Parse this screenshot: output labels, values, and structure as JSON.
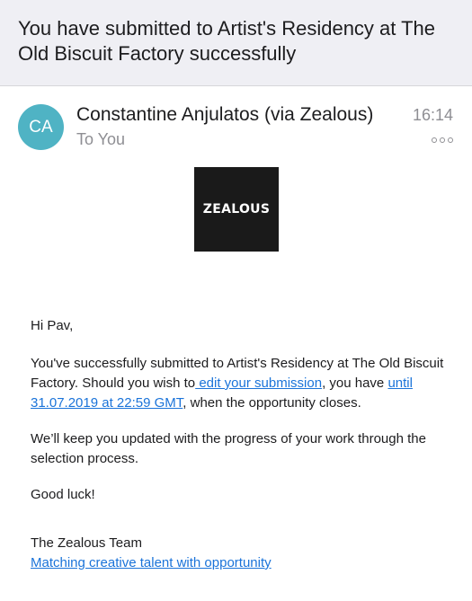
{
  "email": {
    "subject": "You have submitted to Artist's Residency at The Old Biscuit Factory successfully",
    "avatar_initials": "CA",
    "sender": "Constantine Anjulatos (via Zealous)",
    "recipient": "To You",
    "time": "16:14",
    "logo_text": "ZEALOUS",
    "greeting": "Hi Pav,",
    "para1_before": "You've successfully submitted to Artist's Residency at The Old Biscuit Factory. Should you wish to",
    "para1_link": " edit your submission",
    "para1_middle": ", you have ",
    "para1_deadline_link": "until 31.07.2019 at 22:59 GMT",
    "para1_after": ", when the opportunity closes.",
    "para2": "We’ll keep you updated with the progress of your work through the selection process.",
    "para3": "Good luck!",
    "signature_name": "The Zealous Team",
    "signature_link": "Matching creative talent with opportunity"
  }
}
